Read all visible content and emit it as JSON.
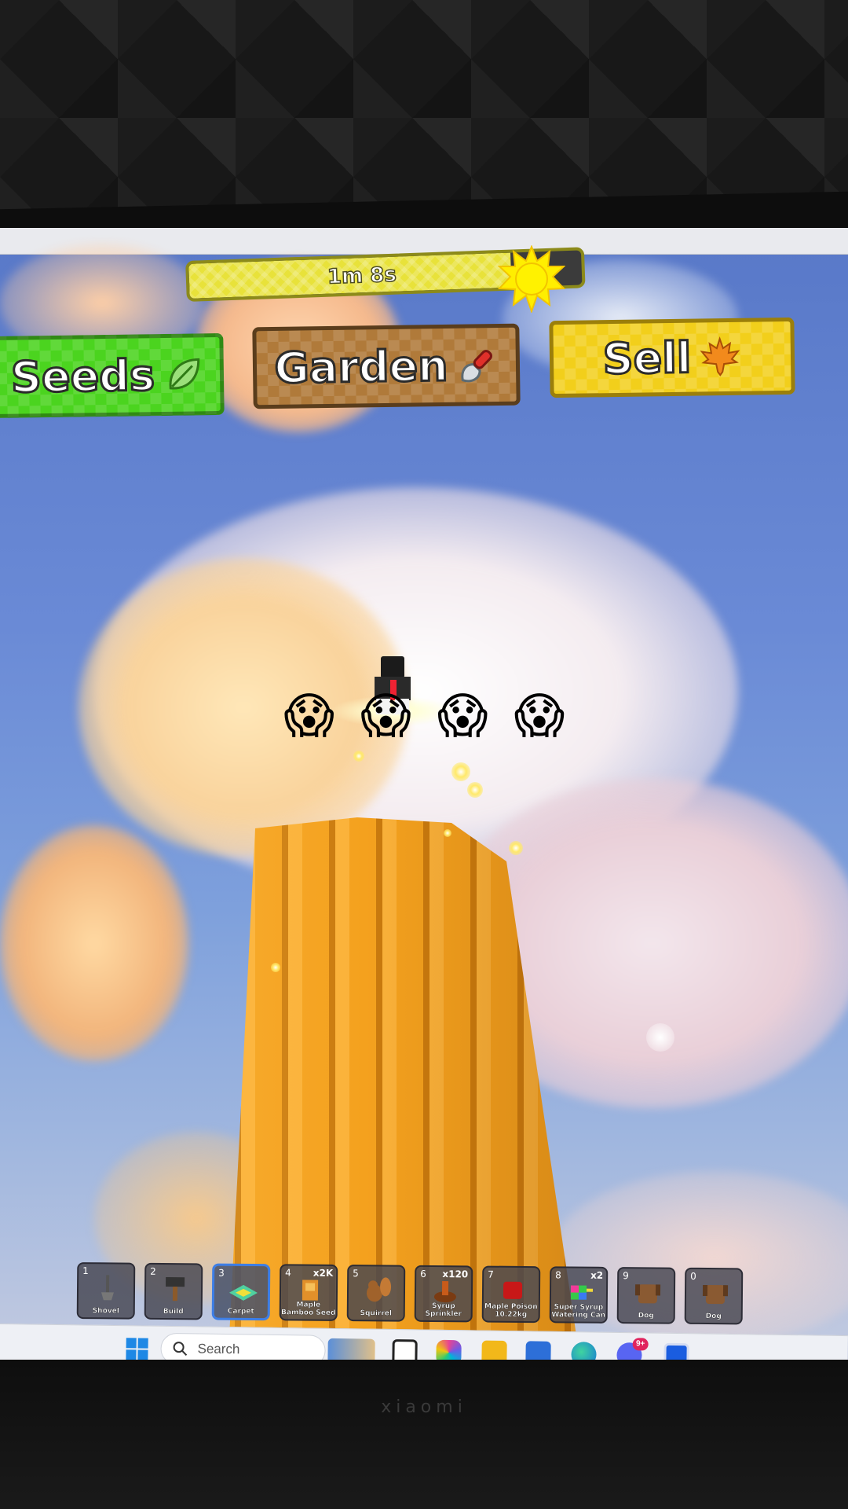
{
  "game": {
    "timer": {
      "text": "1m 8s",
      "progress": 0.82
    },
    "buttons": {
      "seeds": "Seeds",
      "garden": "Garden",
      "sell": "Sell"
    },
    "overlay_emoji": [
      "😱",
      "😱",
      "😱",
      "😱"
    ],
    "hotbar": [
      {
        "slot": "1",
        "name": "Shovel",
        "count": "",
        "icon": "shovel-icon"
      },
      {
        "slot": "2",
        "name": "Build",
        "count": "",
        "icon": "hammer-icon"
      },
      {
        "slot": "3",
        "name": "Carpet",
        "count": "",
        "icon": "carpet-icon",
        "selected": true
      },
      {
        "slot": "4",
        "name": "Maple Bamboo Seed",
        "count": "x2K",
        "icon": "seed-icon"
      },
      {
        "slot": "5",
        "name": "Squirrel",
        "count": "",
        "icon": "squirrel-icon"
      },
      {
        "slot": "6",
        "name": "Syrup Sprinkler",
        "count": "x120",
        "icon": "sprinkler-icon"
      },
      {
        "slot": "7",
        "name": "Maple Poison 10.22kg",
        "count": "",
        "icon": "poison-icon"
      },
      {
        "slot": "8",
        "name": "Super Syrup Watering Can",
        "count": "x2",
        "icon": "watering-can-icon"
      },
      {
        "slot": "9",
        "name": "Dog",
        "count": "",
        "icon": "dog-icon"
      },
      {
        "slot": "0",
        "name": "Dog",
        "count": "",
        "icon": "dog-icon"
      }
    ]
  },
  "taskbar": {
    "search_placeholder": "Search",
    "discord_badge": "9+"
  },
  "monitor": {
    "brand": "xiaomi"
  },
  "colors": {
    "seeds_button": "#4bd41f",
    "garden_button": "#b07a3a",
    "sell_button": "#f2cf1b",
    "timer_fill": "#e8e23a",
    "tower": "#f4a11e",
    "selected_slot": "#3d7ee6"
  }
}
